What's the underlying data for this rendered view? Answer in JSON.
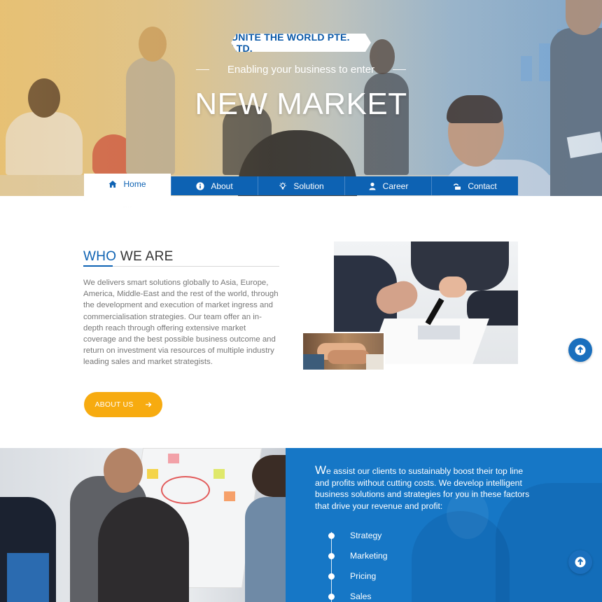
{
  "hero": {
    "brand": "UNITE THE WORLD PTE. LTD.",
    "tagline": "Enabling your business to enter",
    "title": "NEW MARKET"
  },
  "nav": {
    "items": [
      {
        "label": "Home",
        "icon": "home-icon",
        "active": true
      },
      {
        "label": "About",
        "icon": "info-icon",
        "active": false
      },
      {
        "label": "Solution",
        "icon": "lightbulb-icon",
        "active": false
      },
      {
        "label": "Career",
        "icon": "user-icon",
        "active": false
      },
      {
        "label": "Contact",
        "icon": "contact-icon",
        "active": false
      }
    ]
  },
  "who": {
    "heading_accent": "WHO",
    "heading_rest": " WE ARE",
    "body": "We delivers smart solutions globally to Asia, Europe, America, Middle-East and the rest of the world, through the development and execution of market ingress and commercialisation strategies. Our team offer an in-depth reach through offering extensive market coverage and the best possible business outcome and return on investment via resources of multiple industry leading sales and market strategists.",
    "button_label": "ABOUT US"
  },
  "assist": {
    "first_letter": "W",
    "text": "e assist our clients to sustainably boost their top line and profits without cutting costs. We develop intelligent business solutions and strategies for you in these factors that drive your revenue and profit:",
    "factors": [
      "Strategy",
      "Marketing",
      "Pricing",
      "Sales"
    ]
  },
  "colors": {
    "brand_blue": "#0d62b3",
    "accent_orange": "#f7ab10",
    "panel_blue": "#1677c6"
  }
}
